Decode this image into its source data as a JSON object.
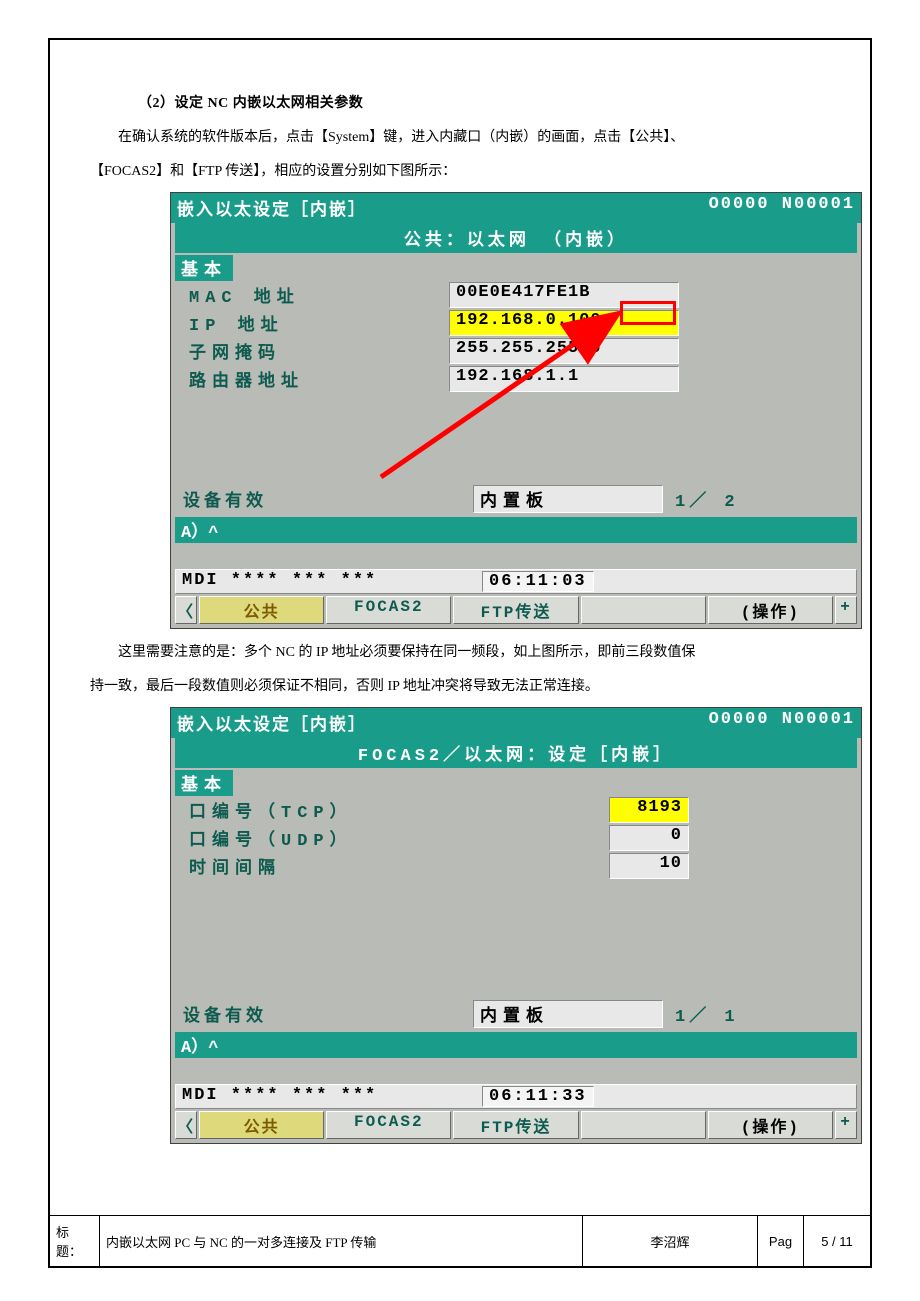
{
  "heading": "（2）设定 NC 内嵌以太网相关参数",
  "para1": "在确认系统的软件版本后，点击【System】键，进入内藏口（内嵌）的画面，点击【公共】、",
  "para1b": "【FOCAS2】和【FTP 传送】，相应的设置分别如下图所示：",
  "screen1": {
    "title_left": "嵌入以太设定［内嵌］",
    "title_right": "O0000 N00001",
    "subtitle": "公共：以太网 （内嵌）",
    "section": "基本",
    "rows": {
      "mac_label": "MAC 地址",
      "mac_val": "00E0E417FE1B",
      "ip_label": "IP 地址",
      "ip_val": "192.168.0.100",
      "mask_label": "子网掩码",
      "mask_val": "255.255.255.0",
      "router_label": "路由器地址",
      "router_val": "192.168.1.1"
    },
    "foot_label": "设备有效",
    "foot_val": "内置板",
    "foot_page": "1／ 2",
    "teal_strip": "A）^",
    "mdi": "MDI  **** *** ***",
    "time": "06:11:03",
    "softkeys": {
      "k0": "〈",
      "k1": "公共",
      "k2": "FOCAS2",
      "k3": "FTP传送",
      "k4": "",
      "k5": "(操作)",
      "k6": "+"
    }
  },
  "para2": "这里需要注意的是：多个 NC 的 IP 地址必须要保持在同一频段，如上图所示，即前三段数值保",
  "para2b": "持一致，最后一段数值则必须保证不相同，否则 IP 地址冲突将导致无法正常连接。",
  "screen2": {
    "title_left": "嵌入以太设定［内嵌］",
    "title_right": "O0000 N00001",
    "subtitle": "FOCAS2／以太网：设定［内嵌］",
    "section": "基本",
    "rows": {
      "tcp_label": "口编号（TCP）",
      "tcp_val": "8193",
      "udp_label": "口编号（UDP）",
      "udp_val": "0",
      "int_label": "时间间隔",
      "int_val": "10"
    },
    "foot_label": "设备有效",
    "foot_val": "内置板",
    "foot_page": "1／ 1",
    "teal_strip": "A）^",
    "mdi": "MDI  **** *** ***",
    "time": "06:11:33",
    "softkeys": {
      "k0": "〈",
      "k1": "公共",
      "k2": "FOCAS2",
      "k3": "FTP传送",
      "k4": "",
      "k5": "(操作)",
      "k6": "+"
    }
  },
  "footer": {
    "label": "标题：",
    "title": "内嵌以太网 PC 与 NC 的一对多连接及 FTP 传输",
    "author": "李沼辉",
    "pag": "Pag",
    "num": "5 / 11"
  }
}
